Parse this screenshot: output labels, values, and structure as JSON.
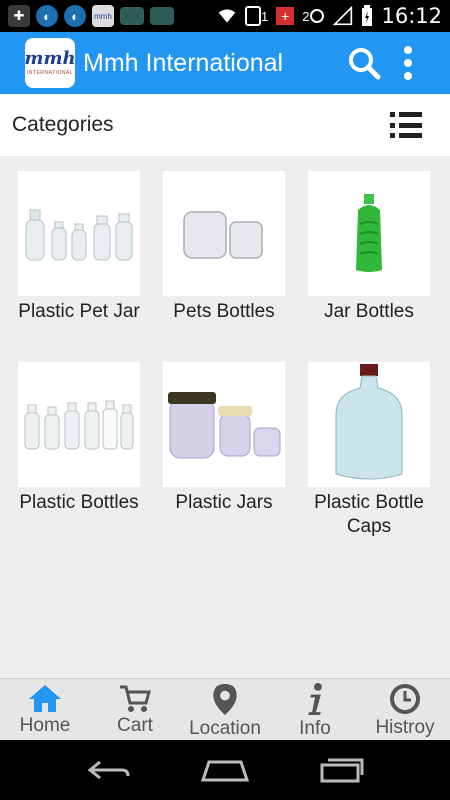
{
  "status_bar": {
    "time": "16:12",
    "sim1": "1",
    "sim2": "2",
    "notification_icons": [
      "plus-icon",
      "globe-icon",
      "globe-icon",
      "app-icon",
      "screen-icon",
      "screen-icon"
    ]
  },
  "app_bar": {
    "logo_text": "mmh",
    "logo_subtext": "INTERNATIONAL",
    "title": "Mmh International",
    "icons": [
      "search-icon",
      "more-vert-icon"
    ]
  },
  "section": {
    "title": "Categories",
    "view_toggle_icon": "list-view-icon"
  },
  "categories": [
    {
      "label": "Plastic Pet Jar",
      "icon": "pet-jar-bottles-image"
    },
    {
      "label": "Pets Bottles",
      "icon": "jars-image"
    },
    {
      "label": "Jar Bottles",
      "icon": "green-bottle-image"
    },
    {
      "label": "Plastic Bottles",
      "icon": "clear-bottles-image"
    },
    {
      "label": "Plastic Jars",
      "icon": "capped-jars-image"
    },
    {
      "label": "Plastic Bottle Caps",
      "icon": "large-bottle-image"
    }
  ],
  "bottom_nav": [
    {
      "label": "Home",
      "icon": "home-icon",
      "active": true
    },
    {
      "label": "Cart",
      "icon": "cart-icon"
    },
    {
      "label": "Location",
      "icon": "location-pin-icon"
    },
    {
      "label": "Info",
      "icon": "info-icon"
    },
    {
      "label": "Histroy",
      "icon": "history-clock-icon"
    }
  ],
  "colors": {
    "primary": "#2196f3",
    "active_nav": "#2196f3",
    "background": "#eeeeee"
  }
}
